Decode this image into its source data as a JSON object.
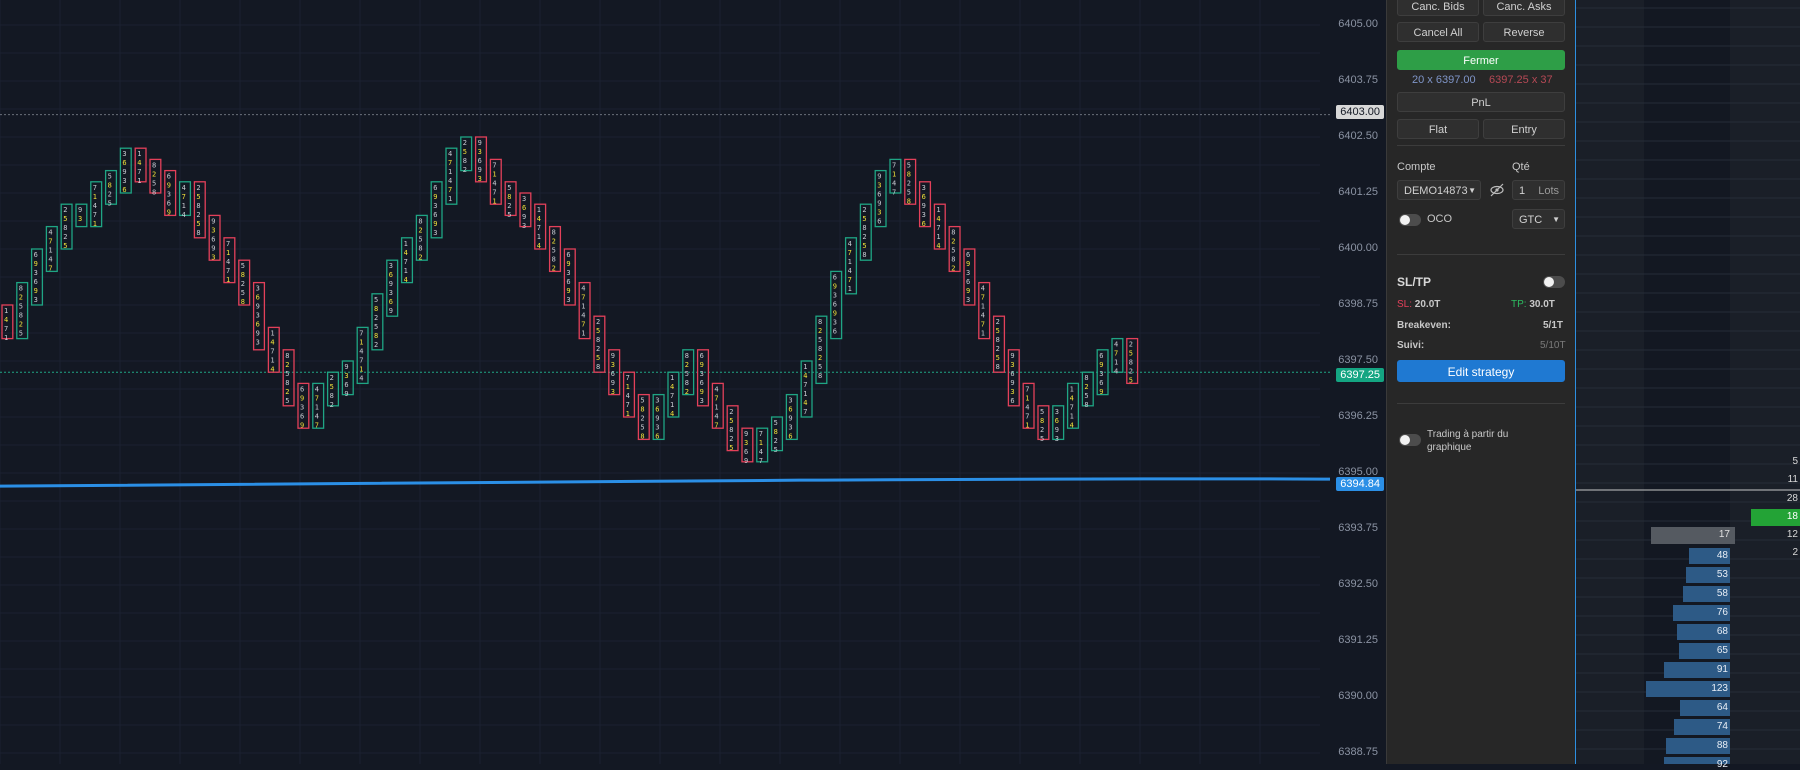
{
  "chart": {
    "price_axis": [
      "6405.00",
      "6403.75",
      "6402.50",
      "6401.25",
      "6400.00",
      "6398.75",
      "6397.50",
      "6396.25",
      "6395.00",
      "6393.75",
      "6392.50",
      "6391.25",
      "6390.00",
      "6388.75"
    ],
    "tags": {
      "high": "6403.00",
      "last": "6397.25",
      "vwap": "6394.84"
    },
    "colors": {
      "bull": "#1fa584",
      "bear": "#e3405a",
      "vwap": "#2b8fe6",
      "last_tag": "#14a582",
      "vwap_tag": "#2b8fe6"
    }
  },
  "panel": {
    "canc_bids": "Canc. Bids",
    "canc_asks": "Canc. Asks",
    "cancel_all": "Cancel All",
    "reverse": "Reverse",
    "fermer": "Fermer",
    "position_left": "20 x 6397.00",
    "position_right": "6397.25 x 37",
    "pnl": "PnL",
    "flat": "Flat",
    "entry": "Entry",
    "compte_label": "Compte",
    "qte_label": "Qté",
    "account": "DEMO14873",
    "qty": "1",
    "lots": "Lots",
    "oco": "OCO",
    "tif": "GTC",
    "sltp": "SL/TP",
    "sl_label": "SL:",
    "sl_value": "20.0T",
    "tp_label": "TP:",
    "tp_value": "30.0T",
    "breakeven_label": "Breakeven:",
    "breakeven_value": "5/1T",
    "suivi_label": "Suivi:",
    "suivi_value": "5/10T",
    "edit_strategy": "Edit strategy",
    "trading_chart_line1": "Trading à partir du",
    "trading_chart_line2": "graphique"
  },
  "dom": {
    "top_right": [
      "5",
      "11",
      "28"
    ],
    "last_right": "18",
    "row_12": {
      "left": "17",
      "right": "12"
    },
    "row_2": "2",
    "bid_sizes": [
      48,
      53,
      58,
      76,
      68,
      65,
      91,
      123,
      64,
      74,
      88,
      92
    ]
  }
}
